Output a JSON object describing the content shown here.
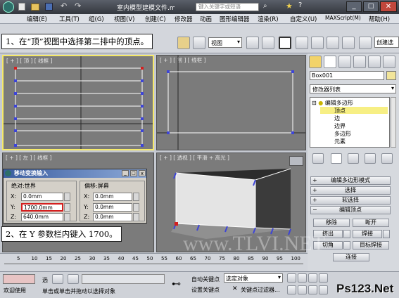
{
  "window": {
    "title": "室内模型建模文件.max",
    "search_placeholder": "键入关键字或短语"
  },
  "menu": [
    "编辑(E)",
    "工具(T)",
    "组(G)",
    "视图(V)",
    "创建(C)",
    "修改器",
    "动画",
    "图形编辑器",
    "渲染(R)",
    "自定义(U)",
    "MAXScript(M)",
    "帮助(H)"
  ],
  "toolbar": {
    "view_select": "视图",
    "create_selection": "创建选"
  },
  "callouts": {
    "step1": "1、在“顶”视图中选择第二排中的顶点。",
    "step2": "2、在 Y 参数栏内键入 1700。"
  },
  "viewports": {
    "top": "[ + ] [ 顶 ] [ 线框 ]",
    "front": "[ + ] [ 前 ] [ 线框 ]",
    "left": "[ + ] [ 左 ] [ 线框 ]",
    "perspective": "[ + ] [ 透视 ] [ 平滑 + 高光 ]"
  },
  "dialog": {
    "title": "移动变换输入",
    "absolute_group": "绝对:世界",
    "offset_group": "偏移:屏幕",
    "x_label": "X:",
    "y_label": "Y:",
    "z_label": "Z:",
    "abs_x": "0.0mm",
    "abs_y": "1700.0mm",
    "abs_z": "640.0mm",
    "off_x": "0.0mm",
    "off_y": "0.0mm",
    "off_z": "0.0mm"
  },
  "command_panel": {
    "object_name": "Box001",
    "modifier_list": "修改器列表",
    "stack": [
      "编辑多边形",
      "顶点",
      "边",
      "边界",
      "多边形",
      "元素"
    ],
    "rollouts": [
      "编辑多边形模式",
      "选择",
      "软选择",
      "编辑顶点"
    ],
    "buttons": {
      "remove": "移除",
      "break": "断开",
      "extrude": "挤出",
      "weld": "焊接",
      "chamfer": "切角",
      "target_weld": "目标焊接",
      "connect": "连接"
    }
  },
  "timeline": {
    "ticks": [
      "5",
      "10",
      "15",
      "20",
      "25",
      "30",
      "35",
      "40",
      "45",
      "50",
      "55",
      "60",
      "65",
      "70",
      "75",
      "80",
      "85",
      "90",
      "95",
      "100"
    ]
  },
  "status": {
    "welcome": "欢迎使用",
    "selected": "选",
    "hint": "单击或单击并拖动以选择对象",
    "auto_key": "自动关键点",
    "set_key": "设置关键点",
    "selected_object": "选定对象",
    "key_filters": "关键点过滤器..."
  },
  "watermarks": {
    "center": "www.TLVI.NET",
    "brand": "Ps123.Net"
  },
  "colors": {
    "selected_viewport_border": "#f5e96a",
    "vertex": "#3d44d8",
    "highlight_field": "#d41f1f",
    "stack_selected": "#f7ef84"
  }
}
